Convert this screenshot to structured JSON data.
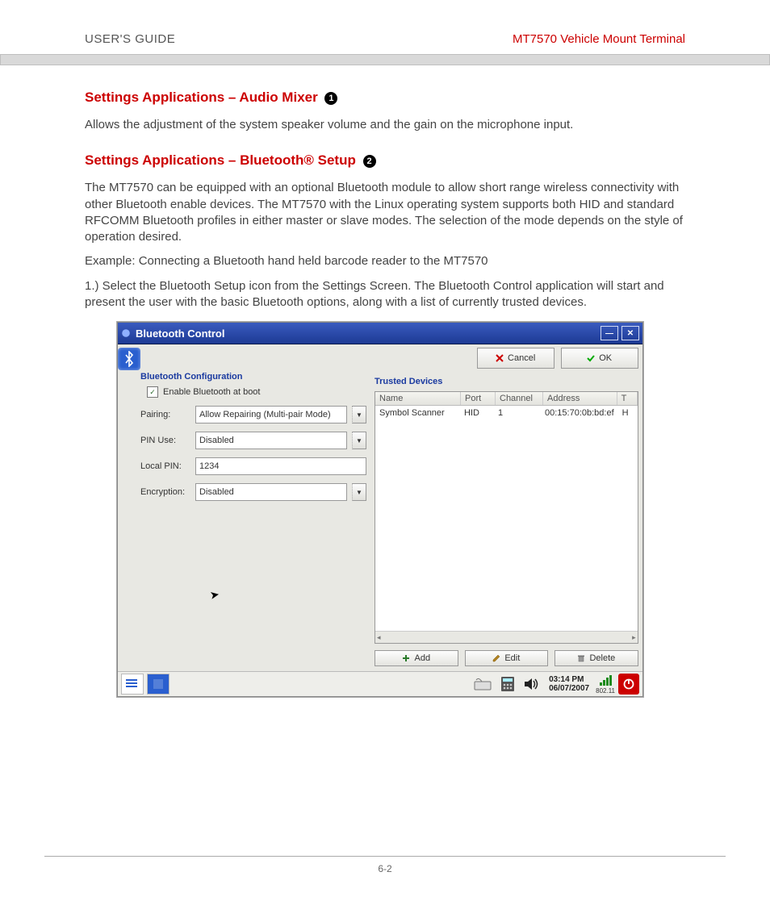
{
  "header": {
    "left": "USER'S GUIDE",
    "right": "MT7570 Vehicle Mount Terminal"
  },
  "section1": {
    "title": "Settings Applications – Audio Mixer",
    "callout": "1",
    "body": "Allows the adjustment of the system speaker volume and the gain on the microphone input."
  },
  "section2": {
    "title": "Settings Applications – Bluetooth® Setup",
    "callout": "2",
    "body1": "The MT7570 can be equipped with an optional Bluetooth module to allow short range wireless connectivity with other Bluetooth enable devices. The MT7570 with the Linux operating system supports both HID and standard RFCOMM Bluetooth profiles in either master or slave modes.  The selection of the mode depends on the style of operation desired.",
    "body2": "Example: Connecting a Bluetooth hand held barcode reader to the MT7570",
    "body3": "1.)  Select the Bluetooth Setup icon from the Settings Screen.  The Bluetooth Control application will start and present the user with the basic Bluetooth options, along with a list of currently trusted devices."
  },
  "app": {
    "title": "Bluetooth Control",
    "buttons": {
      "cancel": "Cancel",
      "ok": "OK",
      "add": "Add",
      "edit": "Edit",
      "delete": "Delete"
    },
    "left_group": "Bluetooth Configuration",
    "checkbox_label": "Enable Bluetooth at boot",
    "fields": {
      "pairing_label": "Pairing:",
      "pairing_value": "Allow Repairing (Multi-pair Mode)",
      "pinuse_label": "PIN Use:",
      "pinuse_value": "Disabled",
      "localpin_label": "Local PIN:",
      "localpin_value": "1234",
      "encryption_label": "Encryption:",
      "encryption_value": "Disabled"
    },
    "right_group": "Trusted Devices",
    "columns": {
      "name": "Name",
      "port": "Port",
      "channel": "Channel",
      "address": "Address",
      "t": "T"
    },
    "row": {
      "name": "Symbol Scanner",
      "port": "HID",
      "channel": "1",
      "address": "00:15:70:0b:bd:ef",
      "t": "H"
    },
    "taskbar": {
      "time": "03:14 PM",
      "date": "06/07/2007",
      "wifi": "802.11"
    }
  },
  "page_number": "6-2"
}
